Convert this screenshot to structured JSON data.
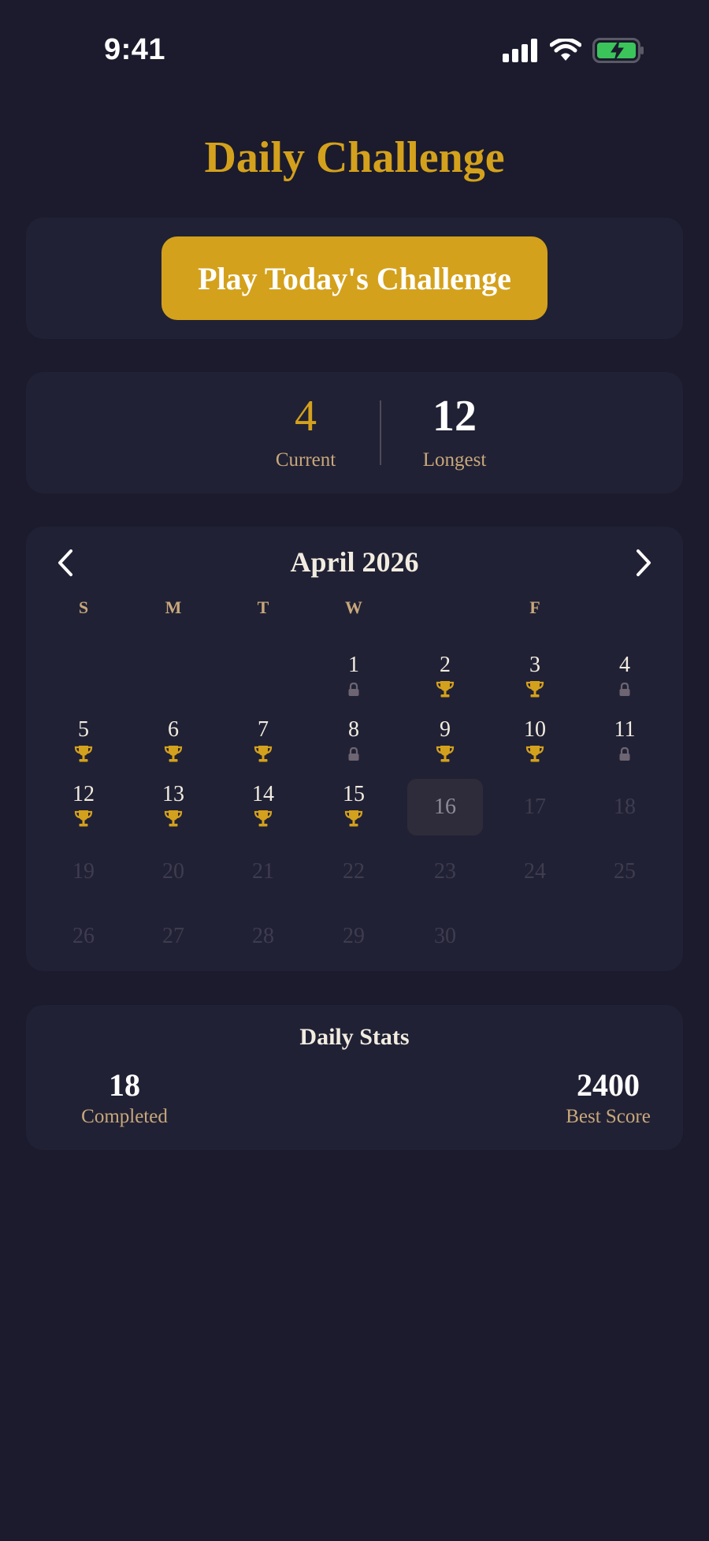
{
  "status_bar": {
    "time": "9:41"
  },
  "title": "Daily Challenge",
  "play_button": "Play Today's Challenge",
  "streak": {
    "current_value": "4",
    "current_label": "Current",
    "longest_value": "12",
    "longest_label": "Longest"
  },
  "calendar": {
    "month": "April 2026",
    "weekdays": [
      "S",
      "M",
      "T",
      "W",
      "",
      "F",
      ""
    ],
    "days": [
      {
        "d": "1",
        "s": "locked"
      },
      {
        "d": "2",
        "s": "trophy"
      },
      {
        "d": "3",
        "s": "trophy"
      },
      {
        "d": "4",
        "s": "locked"
      },
      {
        "d": "5",
        "s": "trophy"
      },
      {
        "d": "6",
        "s": "trophy"
      },
      {
        "d": "7",
        "s": "trophy"
      },
      {
        "d": "8",
        "s": "locked"
      },
      {
        "d": "9",
        "s": "trophy"
      },
      {
        "d": "10",
        "s": "trophy"
      },
      {
        "d": "11",
        "s": "locked"
      },
      {
        "d": "12",
        "s": "trophy"
      },
      {
        "d": "13",
        "s": "trophy"
      },
      {
        "d": "14",
        "s": "trophy"
      },
      {
        "d": "15",
        "s": "trophy"
      },
      {
        "d": "16",
        "s": "today"
      },
      {
        "d": "17",
        "s": "future"
      },
      {
        "d": "18",
        "s": "future"
      },
      {
        "d": "19",
        "s": "future"
      },
      {
        "d": "20",
        "s": "future"
      },
      {
        "d": "21",
        "s": "future"
      },
      {
        "d": "22",
        "s": "future"
      },
      {
        "d": "23",
        "s": "future"
      },
      {
        "d": "24",
        "s": "future"
      },
      {
        "d": "25",
        "s": "future"
      },
      {
        "d": "26",
        "s": "future"
      },
      {
        "d": "27",
        "s": "future"
      },
      {
        "d": "28",
        "s": "future"
      },
      {
        "d": "29",
        "s": "future"
      },
      {
        "d": "30",
        "s": "future"
      }
    ]
  },
  "stats": {
    "title": "Daily Stats",
    "completed_value": "18",
    "completed_label": "Completed",
    "best_value": "2400",
    "best_label": "Best Score"
  },
  "colors": {
    "accent": "#d4a11c",
    "background": "#1b1b2d",
    "card": "#212135",
    "label": "#c8a87a"
  },
  "icons": [
    "signal-icon",
    "wifi-icon",
    "battery-charging-icon",
    "chevron-left-icon",
    "chevron-right-icon",
    "trophy-icon",
    "lock-icon"
  ]
}
